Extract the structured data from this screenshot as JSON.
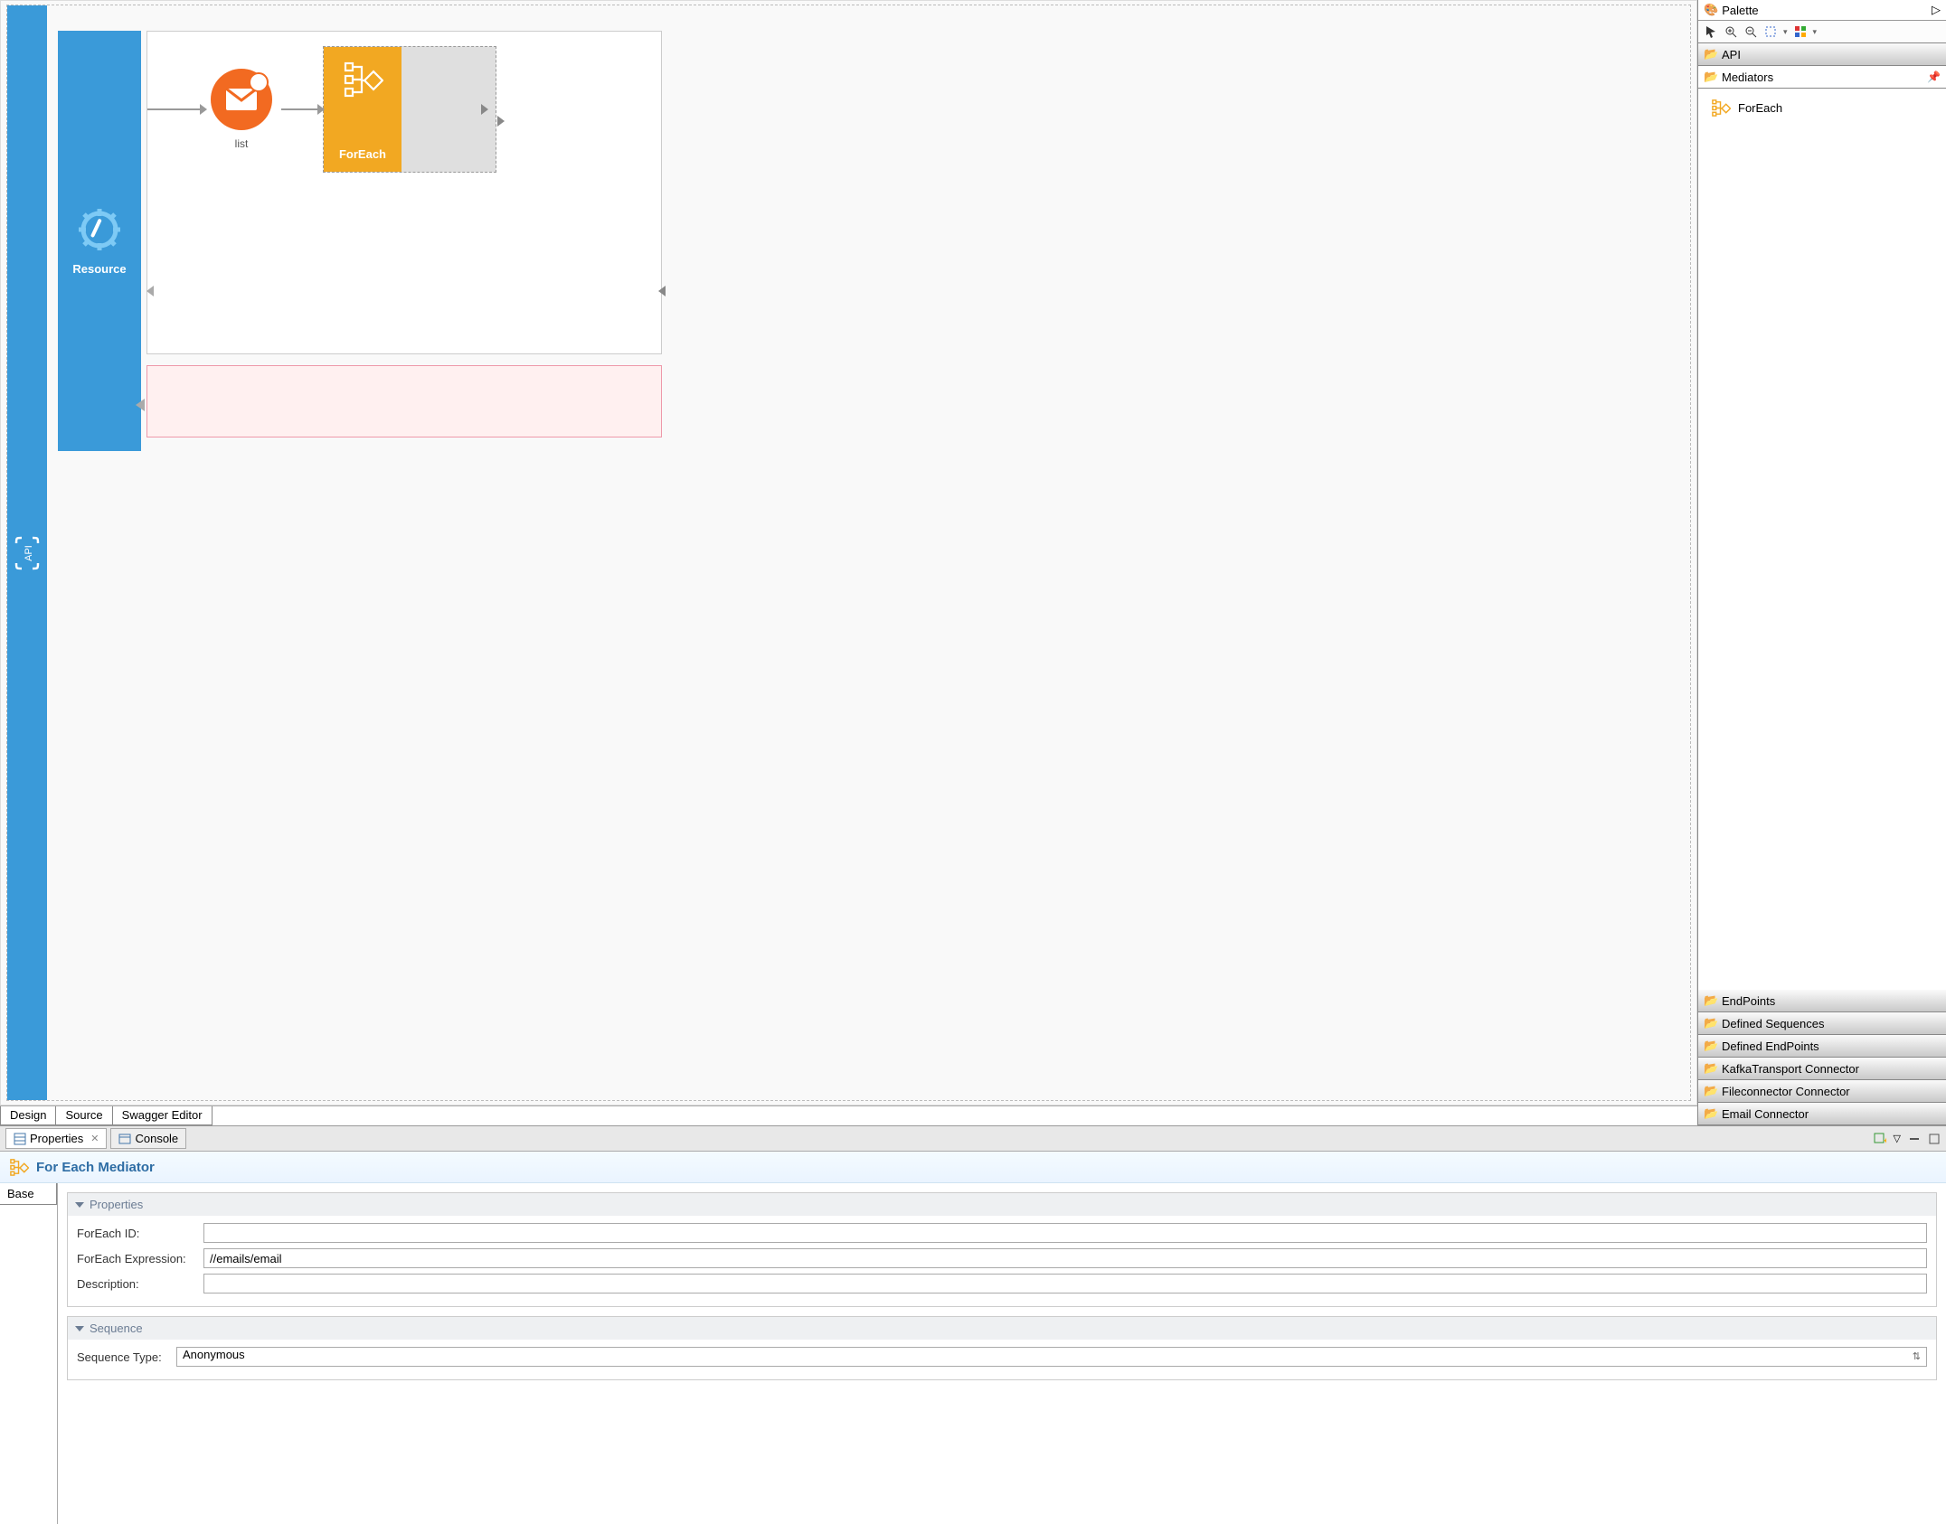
{
  "canvas": {
    "rail_label": "API",
    "resource_label": "Resource",
    "list_node_label": "list",
    "foreach_node_label": "ForEach"
  },
  "editor_tabs": [
    "Design",
    "Source",
    "Swagger Editor"
  ],
  "palette": {
    "title": "Palette",
    "drawers": {
      "api": "API",
      "mediators": "Mediators",
      "endpoints": "EndPoints",
      "defined_sequences": "Defined Sequences",
      "defined_endpoints": "Defined EndPoints",
      "kafka": "KafkaTransport Connector",
      "fileconnector": "Fileconnector Connector",
      "email": "Email Connector"
    },
    "items": {
      "foreach": "ForEach"
    }
  },
  "views": {
    "properties": "Properties",
    "console": "Console"
  },
  "mediator": {
    "title": "For Each Mediator",
    "base_tab": "Base",
    "sections": {
      "properties": "Properties",
      "sequence": "Sequence"
    },
    "labels": {
      "foreach_id": "ForEach ID:",
      "foreach_expression": "ForEach Expression:",
      "description": "Description:",
      "sequence_type": "Sequence Type:"
    },
    "values": {
      "foreach_id": "",
      "foreach_expression": "//emails/email",
      "description": "",
      "sequence_type": "Anonymous"
    }
  }
}
